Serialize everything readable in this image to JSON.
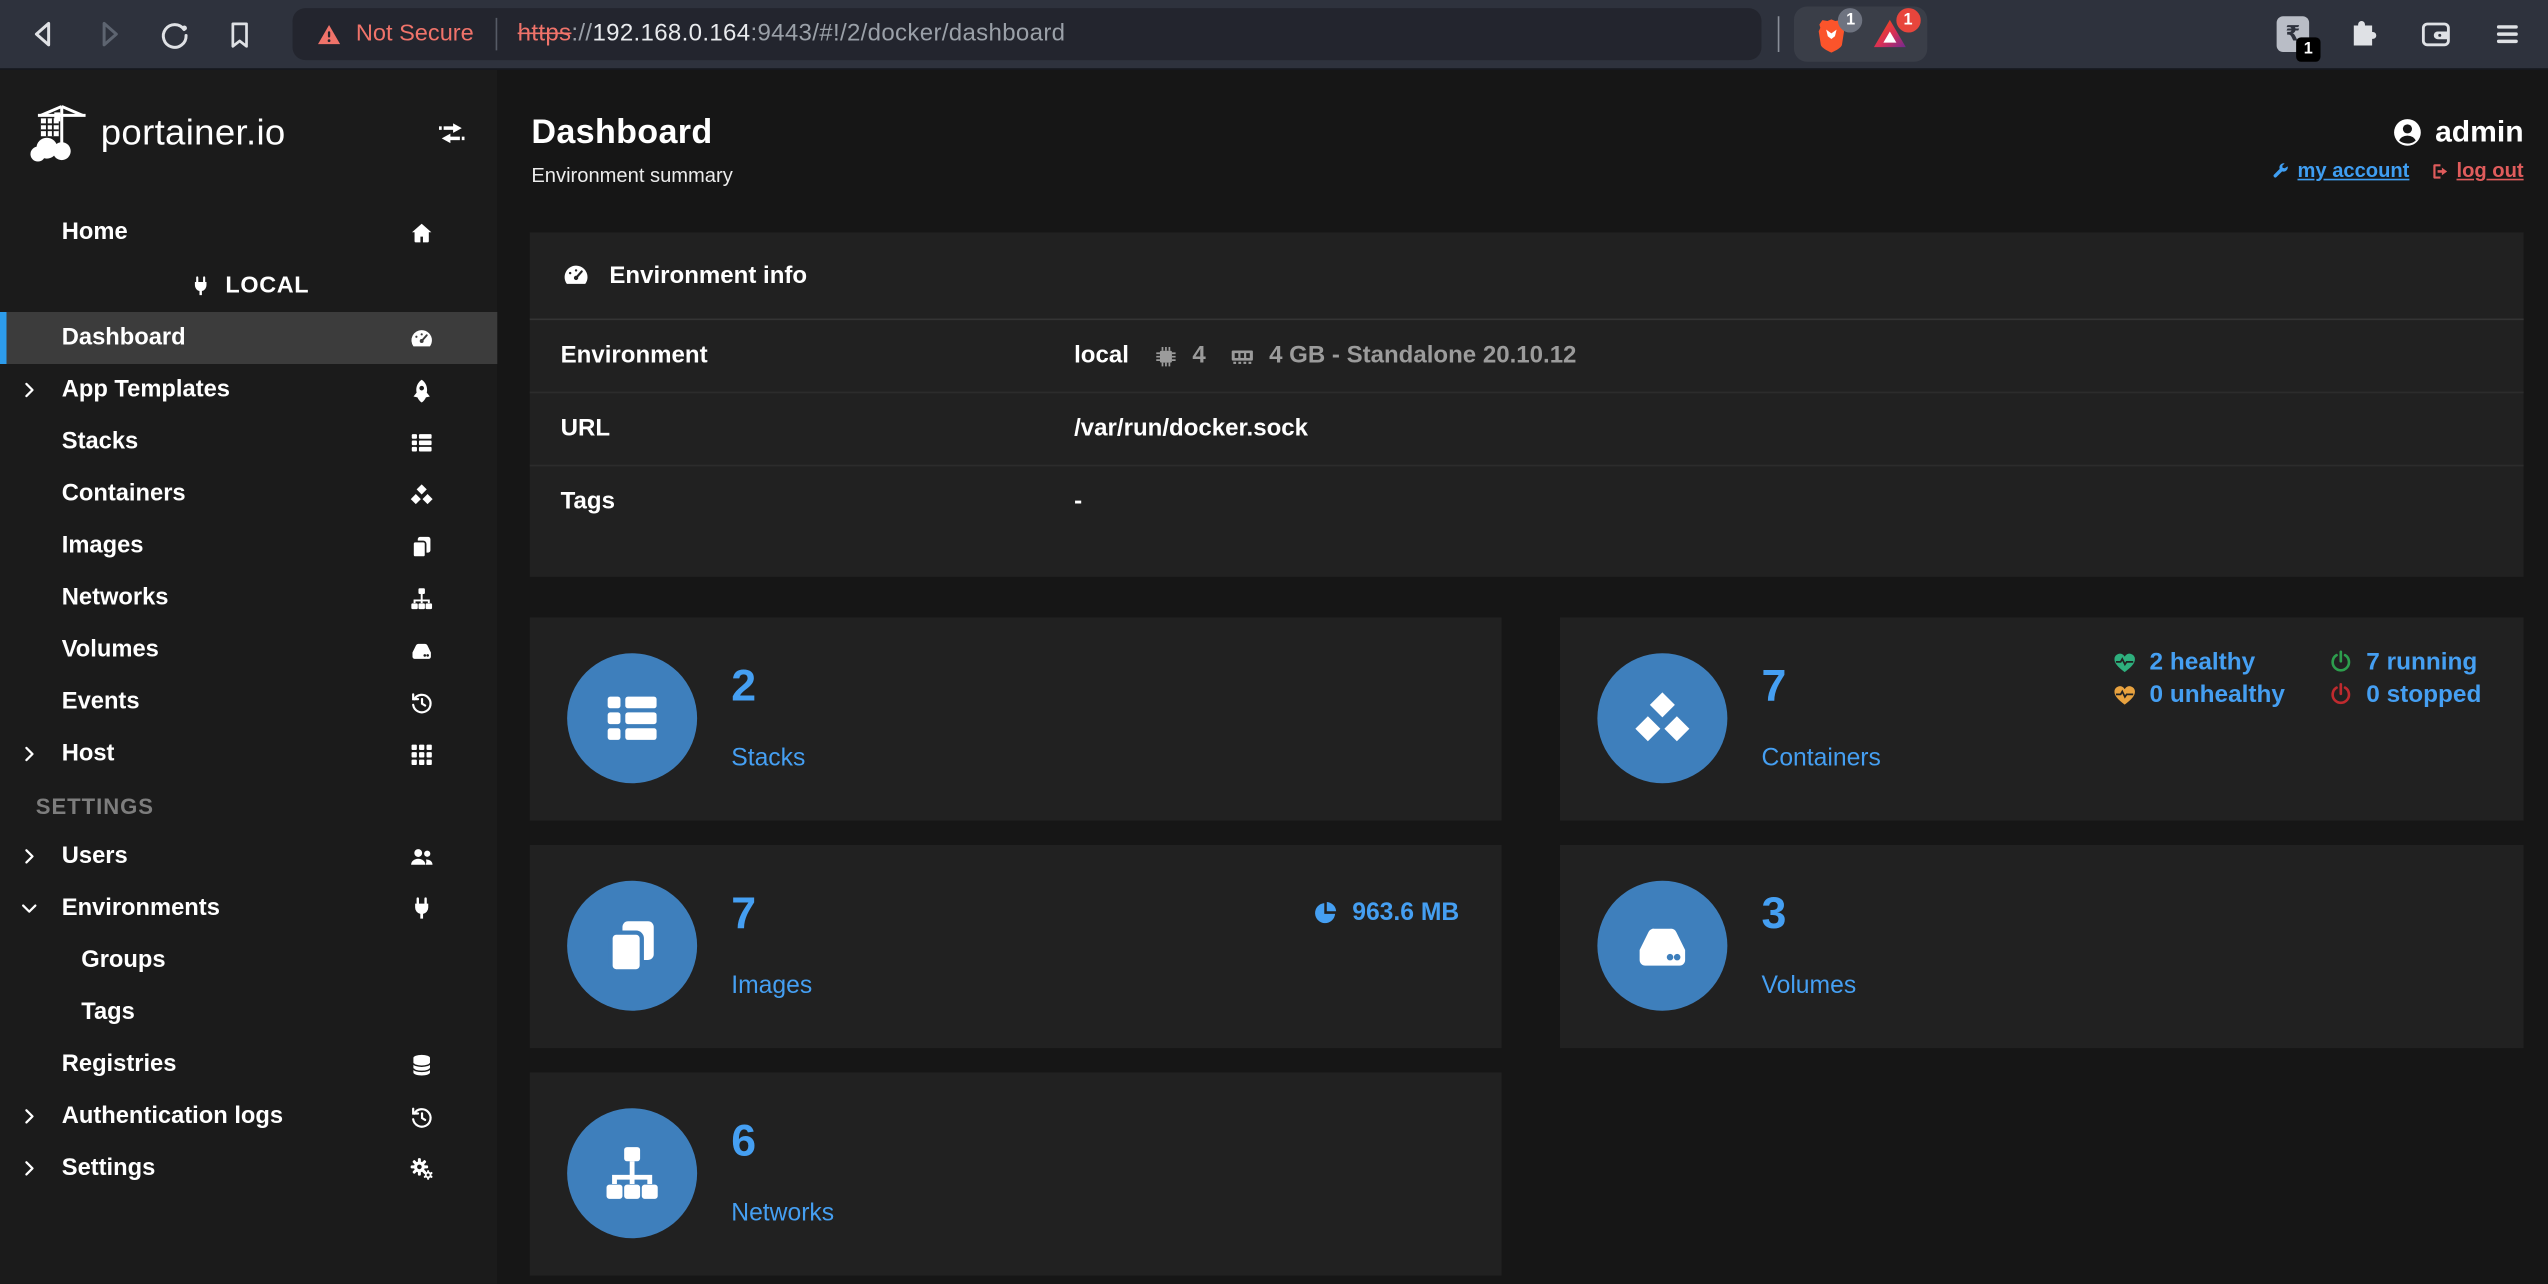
{
  "browser": {
    "not_secure": "Not Secure",
    "url": {
      "scheme": "https",
      "sep": "://",
      "host": "192.168.0.164",
      "path": ":9443/#!/2/docker/dashboard"
    },
    "shield_badge": "1",
    "bat_badge": "1",
    "extension_badge": "1"
  },
  "sidebar": {
    "logo": "portainer.io",
    "home_label": "Home",
    "env_name": "LOCAL",
    "items": [
      {
        "label": "Dashboard"
      },
      {
        "label": "App Templates"
      },
      {
        "label": "Stacks"
      },
      {
        "label": "Containers"
      },
      {
        "label": "Images"
      },
      {
        "label": "Networks"
      },
      {
        "label": "Volumes"
      },
      {
        "label": "Events"
      },
      {
        "label": "Host"
      }
    ],
    "settings_header": "SETTINGS",
    "settings_items": [
      {
        "label": "Users"
      },
      {
        "label": "Environments"
      },
      {
        "label": "Groups"
      },
      {
        "label": "Tags"
      },
      {
        "label": "Registries"
      },
      {
        "label": "Authentication logs"
      },
      {
        "label": "Settings"
      }
    ]
  },
  "header": {
    "title": "Dashboard",
    "subtitle": "Environment summary",
    "username": "admin",
    "my_account": "my account",
    "log_out": "log out"
  },
  "env_info": {
    "title": "Environment info",
    "environment_label": "Environment",
    "environment_name": "local",
    "cpu_count": "4",
    "memory_info": "4 GB - Standalone 20.10.12",
    "url_label": "URL",
    "url_value": "/var/run/docker.sock",
    "tags_label": "Tags",
    "tags_value": "-"
  },
  "cards": [
    {
      "count": "2",
      "label": "Stacks"
    },
    {
      "count": "7",
      "label": "Containers"
    },
    {
      "count": "7",
      "label": "Images",
      "size": "963.6 MB"
    },
    {
      "count": "3",
      "label": "Volumes"
    },
    {
      "count": "6",
      "label": "Networks"
    }
  ],
  "container_status": {
    "healthy": "2 healthy",
    "unhealthy": "0 unhealthy",
    "running": "7 running",
    "stopped": "0 stopped"
  },
  "colors": {
    "accent_blue": "#459ff2",
    "icon_circle_blue": "#3e7fbc",
    "active_item_border": "#2d9ceb",
    "healthy_green": "#2eaf7d",
    "running_green": "#2d9e4d",
    "unhealthy_orange": "#e8a23f",
    "stopped_red": "#bf2a2e",
    "warning_red": "#f0736a"
  }
}
